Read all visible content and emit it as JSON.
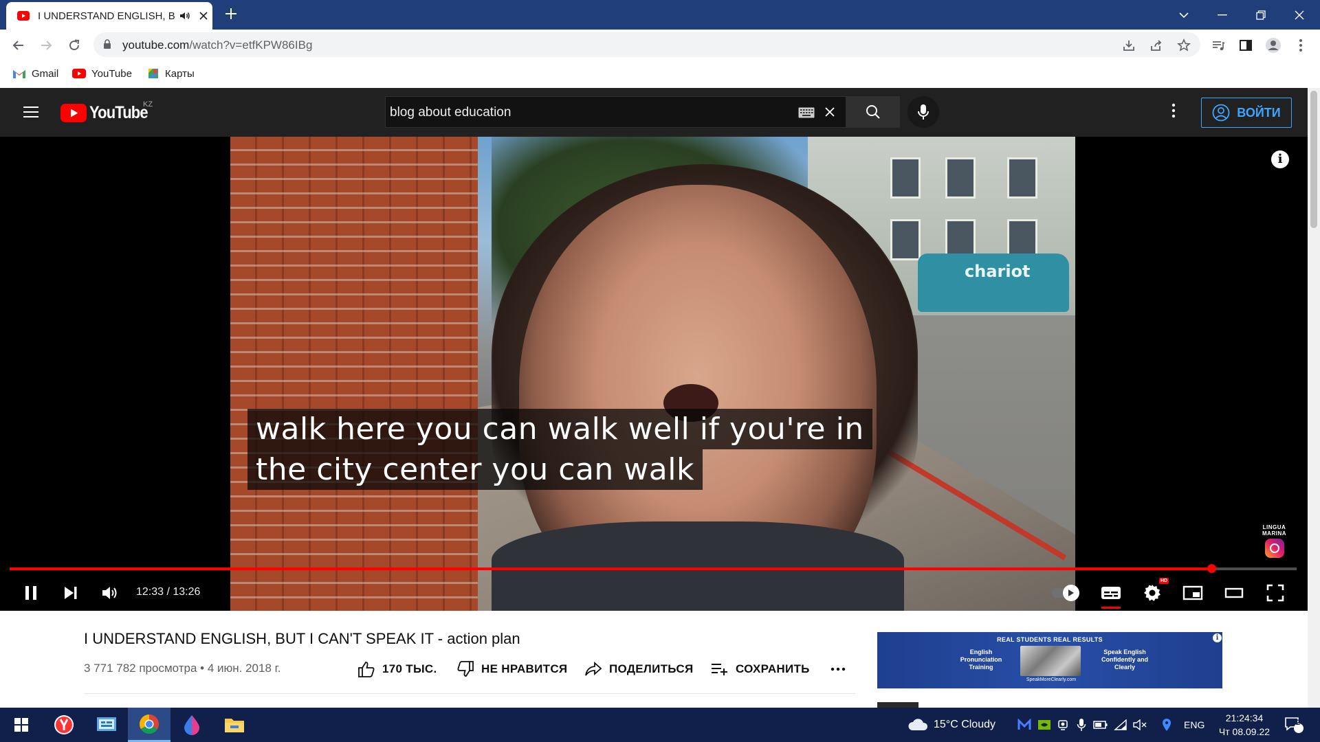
{
  "browser": {
    "tab": {
      "title": "I UNDERSTAND ENGLISH, BU"
    },
    "url": {
      "host": "youtube.com",
      "path": "/watch?v=etfKPW86IBg"
    },
    "bookmarks": [
      {
        "label": "Gmail"
      },
      {
        "label": "YouTube"
      },
      {
        "label": "Карты"
      }
    ]
  },
  "masthead": {
    "logo_text": "YouTube",
    "country_code": "KZ",
    "search_query": "blog about education",
    "signin_label": "ВОЙТИ"
  },
  "player": {
    "captions": [
      "walk here you can walk well if you're in",
      "the city center you can walk"
    ],
    "time_current": "12:33",
    "time_total": "13:26",
    "time_display": "12:33 / 13:26",
    "progress": 0.934,
    "watermark": "LINGUA MARINA",
    "watermark_line1": "LINGUA",
    "watermark_line2": "MARINA",
    "video_scene_text": "chariot",
    "hd_badge": "HD",
    "accent_color": "#ff0000"
  },
  "video": {
    "title": "I UNDERSTAND ENGLISH, BUT I CAN'T SPEAK IT - action plan",
    "views": "3 771 782 просмотра",
    "date": "4 июн. 2018 г.",
    "meta": "3 771 782 просмотра • 4 июн. 2018 г.",
    "actions": {
      "like": "170 ТЫС.",
      "dislike": "НЕ НРАВИТСЯ",
      "share": "ПОДЕЛИТЬСЯ",
      "save": "СОХРАНИТЬ"
    }
  },
  "ad": {
    "headline": "REAL STUDENTS REAL RESULTS",
    "left_text": "English Pronunciation Training",
    "right_text": "Speak English Confidently and Clearly",
    "site": "SpeakMoreClearly.com"
  },
  "taskbar": {
    "weather": "15°C  Cloudy",
    "language": "ENG",
    "time": "21:24:34",
    "date": "Чт 08.09.22",
    "notifications": "2"
  }
}
